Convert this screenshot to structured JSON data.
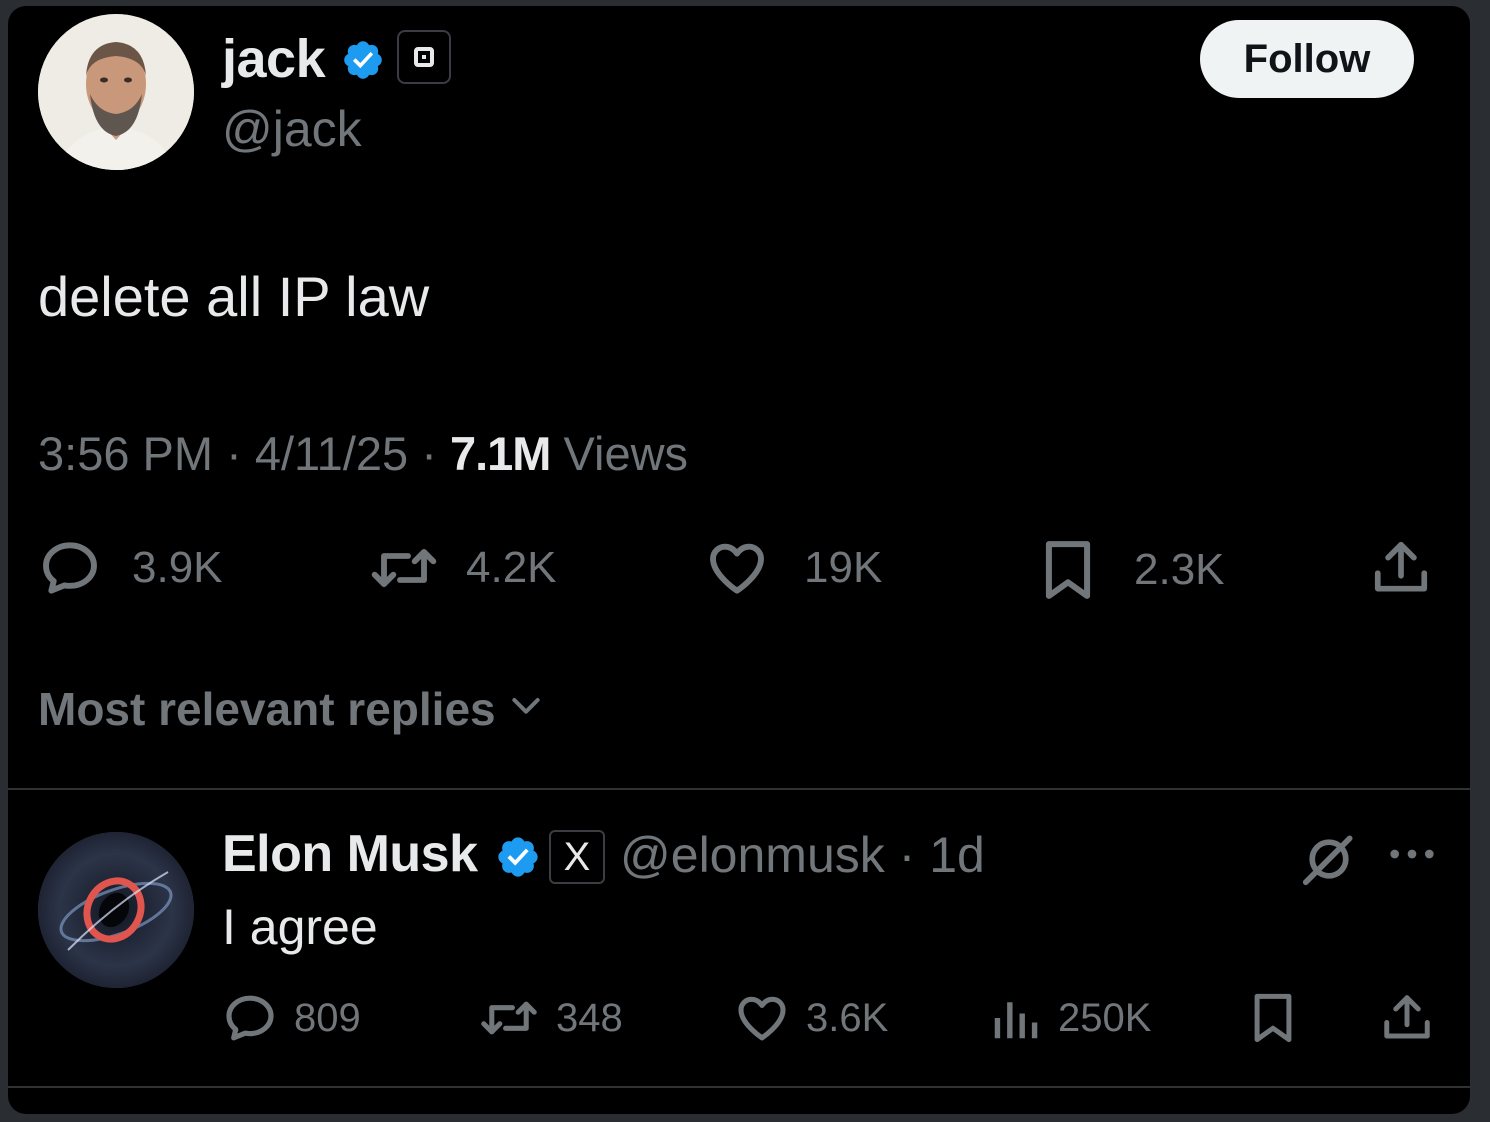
{
  "tweet": {
    "author_name": "jack",
    "author_handle": "@jack",
    "follow_label": "Follow",
    "text": "delete all IP law",
    "time": "3:56 PM",
    "date": "4/11/25",
    "separator": "·",
    "views_count": "7.1M",
    "views_label": "Views",
    "stats": {
      "replies": "3.9K",
      "reposts": "4.2K",
      "likes": "19K",
      "bookmarks": "2.3K"
    }
  },
  "replies_sort_label": "Most relevant replies",
  "reply": {
    "author_name": "Elon Musk",
    "affiliate_badge": "X",
    "author_handle": "@elonmusk",
    "separator": "·",
    "age": "1d",
    "text": "I agree",
    "stats": {
      "replies": "809",
      "reposts": "348",
      "likes": "3.6K",
      "views": "250K"
    }
  },
  "colors": {
    "verified": "#1d9bf0",
    "text_primary": "#e7e9ea",
    "text_secondary": "#71767b",
    "background": "#000000"
  },
  "icons": [
    "verified-icon",
    "reply-icon",
    "repost-icon",
    "like-icon",
    "bookmark-icon",
    "share-icon",
    "views-icon",
    "grok-icon",
    "more-icon",
    "chevron-down-icon"
  ]
}
